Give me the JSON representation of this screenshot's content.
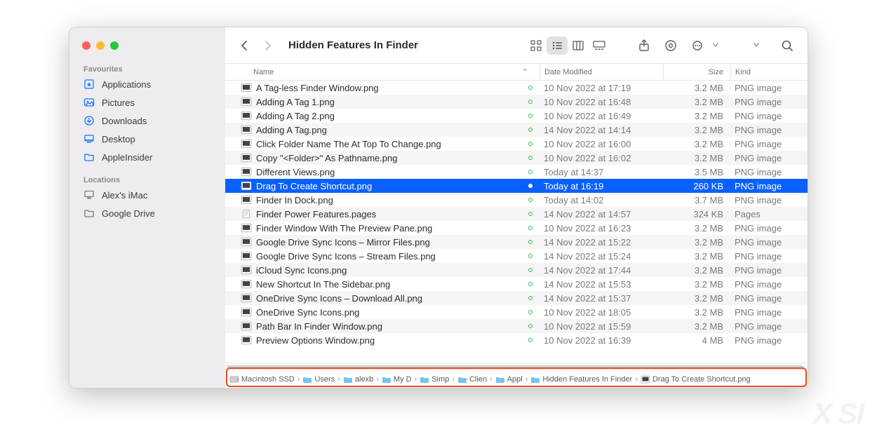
{
  "window_title": "Hidden Features In Finder",
  "sidebar": {
    "section1_head": "Favourites",
    "section2_head": "Locations",
    "favs": [
      {
        "label": "Applications",
        "icon": "apps"
      },
      {
        "label": "Pictures",
        "icon": "pic"
      },
      {
        "label": "Downloads",
        "icon": "down"
      },
      {
        "label": "Desktop",
        "icon": "desk"
      },
      {
        "label": "AppleInsider",
        "icon": "folder"
      }
    ],
    "locs": [
      {
        "label": "Alex's iMac",
        "icon": "imac"
      },
      {
        "label": "Google Drive",
        "icon": "folder-gray"
      }
    ]
  },
  "cols": {
    "name": "Name",
    "dm": "Date Modified",
    "sz": "Size",
    "kd": "Kind"
  },
  "files": [
    {
      "n": "A Tag-less Finder Window.png",
      "d": "10 Nov 2022 at 17:19",
      "s": "3.2 MB",
      "k": "PNG image",
      "t": "img"
    },
    {
      "n": "Adding A Tag 1.png",
      "d": "10 Nov 2022 at 16:48",
      "s": "3.2 MB",
      "k": "PNG image",
      "t": "img"
    },
    {
      "n": "Adding A Tag 2.png",
      "d": "10 Nov 2022 at 16:49",
      "s": "3.2 MB",
      "k": "PNG image",
      "t": "img"
    },
    {
      "n": "Adding A Tag.png",
      "d": "14 Nov 2022 at 14:14",
      "s": "3.2 MB",
      "k": "PNG image",
      "t": "img"
    },
    {
      "n": "Click Folder Name The At Top To Change.png",
      "d": "10 Nov 2022 at 16:00",
      "s": "3.2 MB",
      "k": "PNG image",
      "t": "img"
    },
    {
      "n": "Copy \"<Folder>\" As Pathname.png",
      "d": "10 Nov 2022 at 16:02",
      "s": "3.2 MB",
      "k": "PNG image",
      "t": "img"
    },
    {
      "n": "Different Views.png",
      "d": "Today at 14:37",
      "s": "3.5 MB",
      "k": "PNG image",
      "t": "img"
    },
    {
      "n": "Drag To Create Shortcut.png",
      "d": "Today at 16:19",
      "s": "260 KB",
      "k": "PNG image",
      "t": "img",
      "sel": true
    },
    {
      "n": "Finder In Dock.png",
      "d": "Today at 14:02",
      "s": "3.7 MB",
      "k": "PNG image",
      "t": "img"
    },
    {
      "n": "Finder Power Features.pages",
      "d": "14 Nov 2022 at 14:57",
      "s": "324 KB",
      "k": "Pages",
      "t": "pages"
    },
    {
      "n": "Finder Window With The Preview Pane.png",
      "d": "10 Nov 2022 at 16:23",
      "s": "3.2 MB",
      "k": "PNG image",
      "t": "img"
    },
    {
      "n": "Google Drive Sync Icons – Mirror Files.png",
      "d": "14 Nov 2022 at 15:22",
      "s": "3.2 MB",
      "k": "PNG image",
      "t": "img"
    },
    {
      "n": "Google Drive Sync Icons – Stream Files.png",
      "d": "14 Nov 2022 at 15:24",
      "s": "3.2 MB",
      "k": "PNG image",
      "t": "img"
    },
    {
      "n": "iCloud Sync Icons.png",
      "d": "14 Nov 2022 at 17:44",
      "s": "3.2 MB",
      "k": "PNG image",
      "t": "img"
    },
    {
      "n": "New Shortcut In The Sidebar.png",
      "d": "14 Nov 2022 at 15:53",
      "s": "3.2 MB",
      "k": "PNG image",
      "t": "img"
    },
    {
      "n": "OneDrive Sync Icons – Download All.png",
      "d": "14 Nov 2022 at 15:37",
      "s": "3.2 MB",
      "k": "PNG image",
      "t": "img"
    },
    {
      "n": "OneDrive Sync Icons.png",
      "d": "10 Nov 2022 at 18:05",
      "s": "3.2 MB",
      "k": "PNG image",
      "t": "img"
    },
    {
      "n": "Path Bar In Finder Window.png",
      "d": "10 Nov 2022 at 15:59",
      "s": "3.2 MB",
      "k": "PNG image",
      "t": "img"
    },
    {
      "n": "Preview Options Window.png",
      "d": "10 Nov 2022 at 16:39",
      "s": "4 MB",
      "k": "PNG image",
      "t": "img"
    }
  ],
  "pathbar": [
    {
      "label": "Macintosh SSD",
      "icon": "hdd"
    },
    {
      "label": "Users",
      "icon": "bfolder"
    },
    {
      "label": "alexb",
      "icon": "bfolder"
    },
    {
      "label": "My D",
      "icon": "bfolder"
    },
    {
      "label": "Simp",
      "icon": "bfolder"
    },
    {
      "label": "Clien",
      "icon": "bfolder"
    },
    {
      "label": "Appl",
      "icon": "bfolder"
    },
    {
      "label": "Hidden Features In Finder",
      "icon": "bfolder"
    },
    {
      "label": "Drag To Create Shortcut.png",
      "icon": "img"
    }
  ]
}
